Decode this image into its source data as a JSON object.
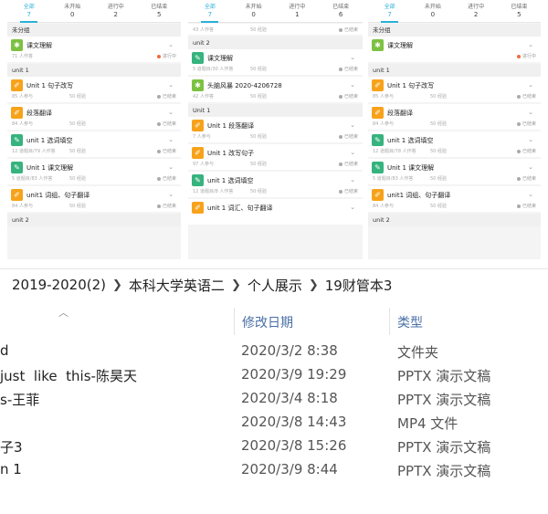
{
  "panels": [
    {
      "tabs": [
        {
          "label": "全部",
          "count": "7",
          "active": true
        },
        {
          "label": "未开始",
          "count": "0"
        },
        {
          "label": "进行中",
          "count": "2"
        },
        {
          "label": "已结束",
          "count": "5"
        }
      ],
      "rows": [
        {
          "kind": "group",
          "label": "未分组"
        },
        {
          "kind": "card",
          "icon": "lime",
          "title": "课文理解",
          "meta_l": "71 人作答",
          "meta_m": "",
          "status": "进行中",
          "running": true
        },
        {
          "kind": "group",
          "label": "unit 1"
        },
        {
          "kind": "card",
          "icon": "orange",
          "title": "Unit 1 句子改写",
          "meta_l": "85 人参与",
          "meta_m": "50 经验",
          "status": "已结束"
        },
        {
          "kind": "card",
          "icon": "orange",
          "title": "段落翻译",
          "meta_l": "84 人参与",
          "meta_m": "50 经验",
          "status": "已结束"
        },
        {
          "kind": "card",
          "icon": "green",
          "title": "unit 1 选词填空",
          "meta_l": "12 道题目/79 人作答",
          "meta_m": "50 经验",
          "status": "已结束"
        },
        {
          "kind": "card",
          "icon": "green",
          "title": "Unit 1 课文理解",
          "meta_l": "5 道题目/83 人作答",
          "meta_m": "50 经验",
          "status": "已结束"
        },
        {
          "kind": "card",
          "icon": "orange",
          "title": "unit1 词组、句子翻译",
          "meta_l": "84 人参与",
          "meta_m": "50 经验",
          "status": "已结束"
        },
        {
          "kind": "group",
          "label": "unit 2"
        }
      ]
    },
    {
      "tabs": [
        {
          "label": "全部",
          "count": "7",
          "active": true
        },
        {
          "label": "未开始",
          "count": "0"
        },
        {
          "label": "进行中",
          "count": "1"
        },
        {
          "label": "已结束",
          "count": "6"
        }
      ],
      "rows": [
        {
          "kind": "partial",
          "meta_l": "43 人作答",
          "meta_m": "50 经验",
          "status": "已结束"
        },
        {
          "kind": "group",
          "label": "unit 2"
        },
        {
          "kind": "card",
          "icon": "green",
          "title": "课文理解",
          "meta_l": "5 道题目/30 人作答",
          "meta_m": "50 经验",
          "status": "已结束"
        },
        {
          "kind": "card",
          "icon": "lime",
          "title": "头脑风暴 2020-4206728",
          "meta_l": "42 人作答",
          "meta_m": "50 经验",
          "status": "已结束"
        },
        {
          "kind": "group",
          "label": "Unit 1"
        },
        {
          "kind": "card",
          "icon": "orange",
          "title": "Unit 1 段落翻译",
          "meta_l": "7 人参与",
          "meta_m": "50 经验",
          "status": "已结束"
        },
        {
          "kind": "card",
          "icon": "orange",
          "title": "Unit 1 改写句子",
          "meta_l": "97 人参与",
          "meta_m": "50 经验",
          "status": "已结束"
        },
        {
          "kind": "card",
          "icon": "green",
          "title": "unit 1 选词填空",
          "meta_l": "12 道题目/8 人作答",
          "meta_m": "50 经验",
          "status": "已结束"
        },
        {
          "kind": "card",
          "icon": "orange",
          "title": "unit 1 词汇、句子翻译",
          "meta_l": "",
          "meta_m": "",
          "status": ""
        }
      ]
    },
    {
      "tabs": [
        {
          "label": "全部",
          "count": "7",
          "active": true
        },
        {
          "label": "未开始",
          "count": "0"
        },
        {
          "label": "进行中",
          "count": "2"
        },
        {
          "label": "已结束",
          "count": "5"
        }
      ],
      "rows": [
        {
          "kind": "group",
          "label": "未分组"
        },
        {
          "kind": "card",
          "icon": "lime",
          "title": "课文理解",
          "meta_l": "",
          "meta_m": "",
          "status": "进行中",
          "running": true
        },
        {
          "kind": "group",
          "label": "unit 1"
        },
        {
          "kind": "card",
          "icon": "orange",
          "title": "Unit 1 句子改写",
          "meta_l": "85 人参与",
          "meta_m": "50 经验",
          "status": "已结束"
        },
        {
          "kind": "card",
          "icon": "orange",
          "title": "段落翻译",
          "meta_l": "84 人参与",
          "meta_m": "50 经验",
          "status": "已结束"
        },
        {
          "kind": "card",
          "icon": "green",
          "title": "unit 1 选词填空",
          "meta_l": "12 道题目/78 人作答",
          "meta_m": "50 经验",
          "status": "已结束"
        },
        {
          "kind": "card",
          "icon": "green",
          "title": "Unit 1 课文理解",
          "meta_l": "5 道题目/83 人作答",
          "meta_m": "50 经验",
          "status": "已结束"
        },
        {
          "kind": "card",
          "icon": "orange",
          "title": "unit1 词组、句子翻译",
          "meta_l": "84 人参与",
          "meta_m": "50 经验",
          "status": "已结束"
        },
        {
          "kind": "group",
          "label": "unit 2"
        }
      ]
    }
  ],
  "explorer": {
    "breadcrumb": [
      "2019-2020(2)",
      "本科大学英语二",
      "个人展示",
      "19财管本3"
    ],
    "columns": {
      "date": "修改日期",
      "type": "类型"
    },
    "files": [
      {
        "name": "d",
        "date": "2020/3/2 8:38",
        "type": "文件夹"
      },
      {
        "name": "just  like  this-陈昊天",
        "date": "2020/3/9 19:29",
        "type": "PPTX 演示文稿"
      },
      {
        "name": "s-王菲",
        "date": "2020/3/4 8:18",
        "type": "PPTX 演示文稿"
      },
      {
        "name": "",
        "date": "2020/3/8 14:43",
        "type": "MP4 文件"
      },
      {
        "name": "子3",
        "date": "2020/3/8 15:26",
        "type": "PPTX 演示文稿"
      },
      {
        "name": "n 1",
        "date": "2020/3/9 8:44",
        "type": "PPTX 演示文稿"
      }
    ]
  },
  "icons": {
    "task": "task-icon",
    "chevron": "chevron-down-icon",
    "sort": "sort-up-icon",
    "separator": "chevron-right-icon"
  },
  "colors": {
    "accent": "#2bb1d8",
    "orange": "#f7a21b",
    "green": "#36b37e",
    "lime": "#7cc142",
    "running": "#f26b3a"
  }
}
